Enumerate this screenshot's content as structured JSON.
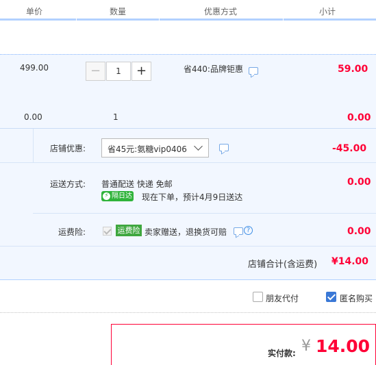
{
  "header": {
    "col_price": "单价",
    "col_qty": "数量",
    "col_discount": "优惠方式",
    "col_subtotal": "小计"
  },
  "item_main": {
    "price": "499.00",
    "quantity": "1",
    "discount": "省440:品牌钜惠",
    "subtotal": "59.00",
    "minus": "−",
    "plus": "+"
  },
  "item_gift": {
    "price": "0.00",
    "quantity": "1",
    "subtotal": "0.00"
  },
  "shop": {
    "coupon_label": "店铺优惠:",
    "coupon_selected": "省45元:氨糖vip0406",
    "coupon_amount": "-45.00",
    "shipping_label": "运送方式:",
    "shipping_method": "普通配送 快递 免邮",
    "shipping_badge": "隔日达",
    "shipping_badge_icon": "⚡",
    "shipping_eta": "现在下单，预计4月9日送达",
    "shipping_amount": "0.00",
    "insurance_label": "运费险:",
    "insurance_tag": "运费险",
    "insurance_desc": "卖家赠送，退换货可赔",
    "insurance_help": "?",
    "insurance_amount": "0.00",
    "total_label": "店铺合计(含运费)",
    "total_amount": "¥14.00"
  },
  "options": {
    "friend_pay": "朋友代付",
    "friend_pay_checked": false,
    "anonymous": "匿名购买",
    "anonymous_checked": true
  },
  "payment": {
    "label": "实付款:",
    "currency": "¥",
    "amount": "14.00"
  },
  "colors": {
    "price_red": "#ff0036",
    "light_blue_bg": "#f2f7ff",
    "header_border": "#b2d1ff",
    "checkbox_blue": "#3a78d6",
    "badge_green": "#2fb33a"
  }
}
